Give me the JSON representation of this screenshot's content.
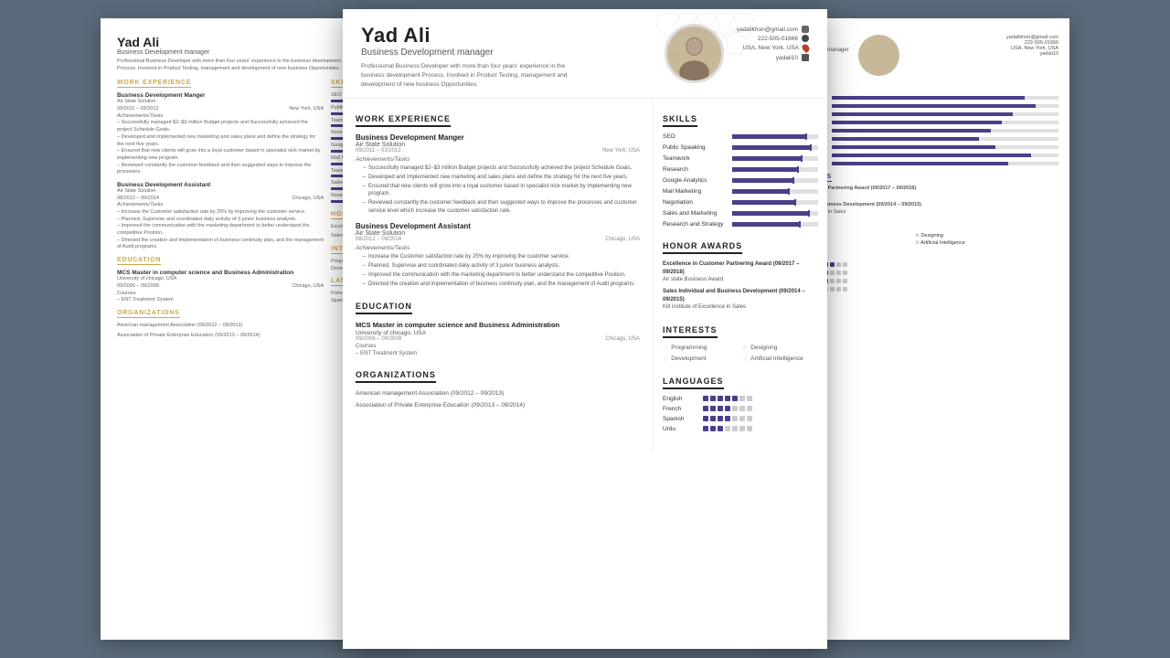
{
  "person": {
    "name": "Yad Ali",
    "title": "Business Development manager",
    "description": "Professional Business Developer with more than four years' experience in the business development Process. Involved in Product Testing, management and development of new business Opportunities.",
    "email": "yadalikhon@gmail.com",
    "phone": "222-505-01666",
    "location": "USA, New York, USA",
    "social": "yadali10"
  },
  "work_experience": {
    "label": "WORK EXPERIENCE",
    "jobs": [
      {
        "title": "Business Development Manger",
        "company": "Air State Solution",
        "dates": "09/2011 – 03/2012",
        "location": "New York, USA",
        "subtitle": "Achievements/Tasks",
        "bullets": [
          "Successfully managed $2–$3 million Budget projects and Successfully achieved the project Schedule Goals.",
          "Developed and Implemented new marketing and sales plans and define the strategy for the next five years.",
          "Ensured that new clients will grow into a loyal customer based in specialist nick market by implementing new program.",
          "Reviewed constantly the customer feedback and then suggested ways to improve the processes and customer service level which increase the customer satisfaction rate."
        ]
      },
      {
        "title": "Business Development Assistant",
        "company": "Air State Solution",
        "dates": "08/2012 – 09/2014",
        "location": "Chicago, USA",
        "subtitle": "Achievements/Tasks",
        "bullets": [
          "Increase the Customer satisfaction rate by 25% by improving the customer service.",
          "Planned, Supervise and coordinated daily activity of 3 junior business analysts.",
          "Improved the communication with the marketing department to better understand the competitive Position.",
          "Directed the creation and implementation of business continuity plan, and the management of Audit programs."
        ]
      }
    ]
  },
  "education": {
    "label": "EDUCATION",
    "items": [
      {
        "degree": "MCS Master in computer science and Business Administration",
        "school": "University of chicago, USA",
        "dates": "09/2006 – 09/2008",
        "location": "Chicago, USA",
        "courses_label": "Courses",
        "course": "– ENT Treatment System"
      }
    ]
  },
  "organizations": {
    "label": "ORGANIZATIONS",
    "items": [
      "American management Association (09/2012 – 09/2013)",
      "Association of Private Enterprise Education (09/2013 – 09/2014)"
    ]
  },
  "skills": {
    "label": "SKILLS",
    "items": [
      {
        "name": "SEO",
        "percent": 85
      },
      {
        "name": "Public Speaking",
        "percent": 90
      },
      {
        "name": "Teamwork",
        "percent": 80
      },
      {
        "name": "Research",
        "percent": 75
      },
      {
        "name": "Google Analytics",
        "percent": 70
      },
      {
        "name": "Mail Marketing",
        "percent": 65
      },
      {
        "name": "Negotiation",
        "percent": 72
      },
      {
        "name": "Sales and Marketing",
        "percent": 88
      },
      {
        "name": "Research and Strategy",
        "percent": 78
      }
    ]
  },
  "honor_awards": {
    "label": "HONOR AWARDS",
    "items": [
      {
        "title": "Excellence in Customer Partnering Award (09/2017 – 09/2018)",
        "org": "Air state Business Award"
      },
      {
        "title": "Sales Individual and Business Development (09/2014 – 09/2015)",
        "org": "Kilt institute of Excellence in Sales"
      }
    ]
  },
  "interests": {
    "label": "INTERESTS",
    "items": [
      {
        "name": "Programming"
      },
      {
        "name": "Designing"
      },
      {
        "name": "Development"
      },
      {
        "name": "Artificial Intelligence"
      }
    ]
  },
  "languages": {
    "label": "LANGUAGES",
    "items": [
      {
        "name": "English",
        "level": 5
      },
      {
        "name": "French",
        "level": 4
      },
      {
        "name": "Spanish",
        "level": 4
      },
      {
        "name": "Urdu",
        "level": 3
      }
    ]
  }
}
